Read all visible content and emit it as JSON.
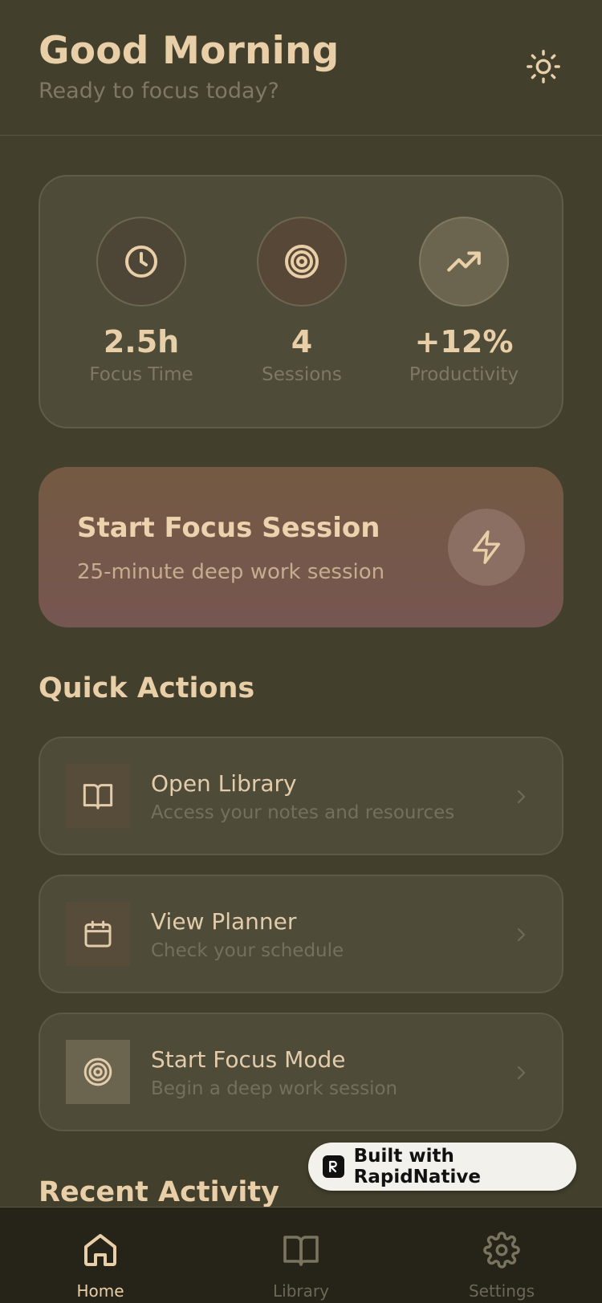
{
  "header": {
    "greeting": "Good Morning",
    "subtitle": "Ready to focus today?"
  },
  "stats": [
    {
      "icon": "clock-icon",
      "value": "2.5h",
      "label": "Focus Time"
    },
    {
      "icon": "target-icon",
      "value": "4",
      "label": "Sessions"
    },
    {
      "icon": "trending-up-icon",
      "value": "+12%",
      "label": "Productivity"
    }
  ],
  "focus_session": {
    "title": "Start Focus Session",
    "subtitle": "25-minute deep work session",
    "icon": "lightning-icon"
  },
  "quick_actions": {
    "title": "Quick Actions",
    "items": [
      {
        "icon": "book-icon",
        "title": "Open Library",
        "subtitle": "Access your notes and resources"
      },
      {
        "icon": "calendar-icon",
        "title": "View Planner",
        "subtitle": "Check your schedule"
      },
      {
        "icon": "target-icon",
        "title": "Start Focus Mode",
        "subtitle": "Begin a deep work session"
      }
    ]
  },
  "recent_activity": {
    "title": "Recent Activity"
  },
  "badge": {
    "text": "Built with RapidNative"
  },
  "tabbar": {
    "tabs": [
      {
        "icon": "home-icon",
        "label": "Home"
      },
      {
        "icon": "book-icon",
        "label": "Library"
      },
      {
        "icon": "gear-icon",
        "label": "Settings"
      }
    ]
  },
  "colors": {
    "background": "#433f2d",
    "accent_text": "#e9cfa8",
    "muted_text": "#7e7864",
    "card": "#4e4b38",
    "tabbar": "#262319"
  }
}
